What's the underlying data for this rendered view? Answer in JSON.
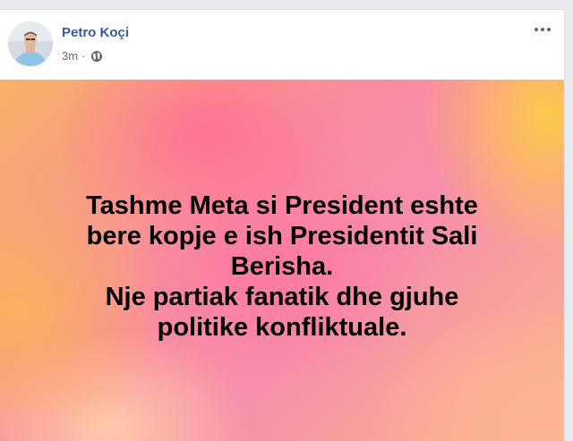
{
  "post": {
    "author": "Petro Koçi",
    "time": "3m",
    "separator": "·",
    "privacy_icon": "globe-icon",
    "more_icon": "more-options-icon",
    "text": "Tashme Meta si President eshte\nbere kopje e ish Presidentit Sali\nBerisha.\nNje partiak fanatik dhe gjuhe\npolitike konfliktuale."
  },
  "colors": {
    "author_link": "#385898",
    "meta_text": "#616770",
    "card_pink": "#f98ba0",
    "card_orange": "#f7b267",
    "card_yellow": "#ffcd46"
  }
}
